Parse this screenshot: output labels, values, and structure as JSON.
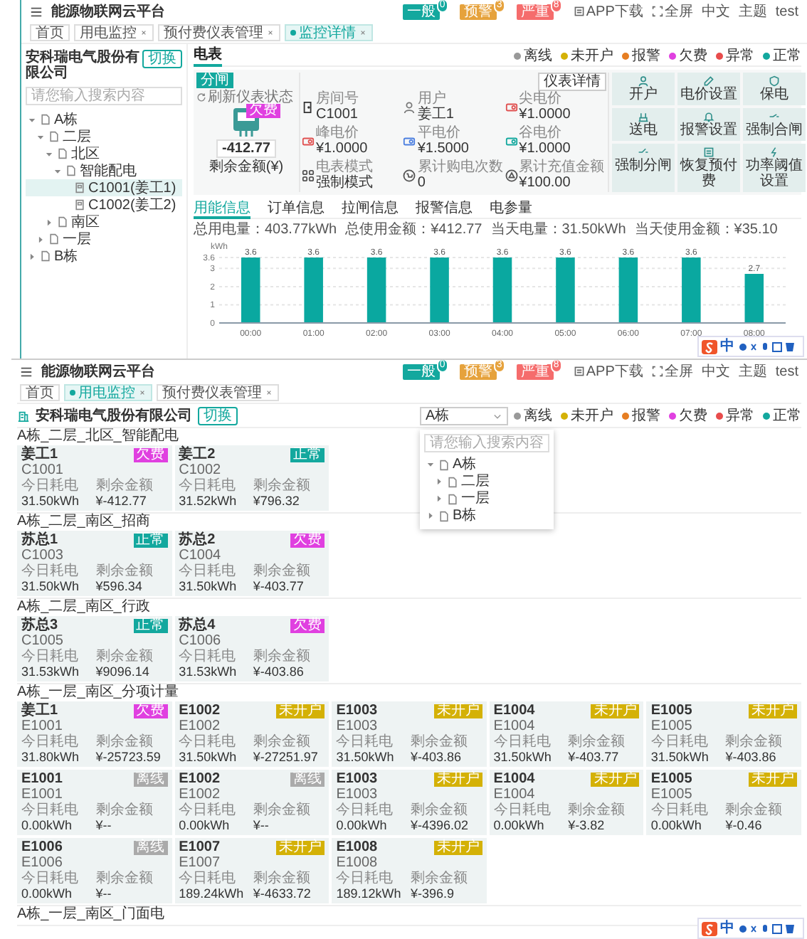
{
  "detail_screen": {
    "header": {
      "title": "能源物联网云平台",
      "alerts": [
        {
          "label": "一般",
          "count": "0",
          "color": "#13a89e"
        },
        {
          "label": "预警",
          "count": "3",
          "color": "#e6a23c"
        },
        {
          "label": "严重",
          "count": "8",
          "color": "#f56c6c"
        }
      ],
      "links": [
        {
          "kind": "app",
          "label": "APP下载"
        },
        {
          "kind": "fullscreen",
          "label": "全屏"
        },
        {
          "kind": "language",
          "label": "中文"
        },
        {
          "kind": "theme",
          "label": "主题"
        },
        {
          "kind": "user",
          "label": "test"
        }
      ]
    },
    "tabs": [
      {
        "label": "首页",
        "selected": false,
        "closable": false
      },
      {
        "label": "用电监控",
        "selected": false,
        "closable": true
      },
      {
        "label": "预付费仪表管理",
        "selected": false,
        "closable": true
      },
      {
        "label": "监控详情",
        "selected": true,
        "closable": true
      }
    ],
    "sidebar": {
      "company": "安科瑞电气股份有限公司",
      "switch_button": "切换",
      "placeholder": "请您输入搜索内容",
      "tree": [
        {
          "label": "A栋",
          "kind": "folder",
          "expanded": true,
          "selected": false,
          "children": [
            {
              "label": "二层",
              "kind": "folder",
              "expanded": true,
              "selected": false,
              "children": [
                {
                  "label": "北区",
                  "kind": "folder",
                  "expanded": true,
                  "selected": false,
                  "children": [
                    {
                      "label": "智能配电",
                      "kind": "folder",
                      "expanded": true,
                      "selected": false,
                      "children": [
                        {
                          "label": "C1001(姜工1)",
                          "kind": "meter",
                          "selected": true
                        },
                        {
                          "label": "C1002(姜工2)",
                          "kind": "meter",
                          "selected": false
                        }
                      ]
                    }
                  ]
                },
                {
                  "label": "南区",
                  "kind": "folder",
                  "expanded": false,
                  "selected": false
                }
              ]
            },
            {
              "label": "一层",
              "kind": "folder",
              "expanded": false,
              "selected": false
            }
          ]
        },
        {
          "label": "B栋",
          "kind": "folder",
          "expanded": false,
          "selected": false
        }
      ]
    },
    "main": {
      "tabs": [
        {
          "label": "电表",
          "selected": true
        }
      ],
      "legend": [
        {
          "label": "离线",
          "color": "#999999"
        },
        {
          "label": "未开户",
          "color": "#d4b106"
        },
        {
          "label": "报警",
          "color": "#e67e22"
        },
        {
          "label": "欠费",
          "color": "#e040e0"
        },
        {
          "label": "异常",
          "color": "#e84c4c"
        },
        {
          "label": "正常",
          "color": "#13a89e"
        }
      ],
      "meter": {
        "switch_state": "分闸",
        "refresh": "刷新仪表状态",
        "status": {
          "label": "欠费",
          "color": "#e040e0"
        },
        "balance": "-412.77",
        "balance_label": "剩余金额(¥)",
        "details_button": "仪表详情",
        "info": [
          {
            "kind": "room",
            "label": "房间号",
            "value": "C1001"
          },
          {
            "kind": "user",
            "label": "用户",
            "value": "姜工1"
          },
          {
            "kind": "tip_price",
            "label": "尖电价",
            "value": "¥1.0000"
          },
          {
            "kind": "peak_price",
            "label": "峰电价",
            "value": "¥1.0000"
          },
          {
            "kind": "flat_price",
            "label": "平电价",
            "value": "¥1.5000"
          },
          {
            "kind": "valley_price",
            "label": "谷电价",
            "value": "¥1.0000"
          },
          {
            "kind": "mode",
            "label": "电表模式",
            "value": "强制模式"
          },
          {
            "kind": "purchase_count",
            "label": "累计购电次数",
            "value": "0"
          },
          {
            "kind": "recharge_total",
            "label": "累计充值金额",
            "value": "¥100.00"
          }
        ],
        "actions": [
          {
            "kind": "open_account",
            "label": "开户"
          },
          {
            "kind": "price_setting",
            "label": "电价设置"
          },
          {
            "kind": "power_guarantee",
            "label": "保电"
          },
          {
            "kind": "power_on",
            "label": "送电"
          },
          {
            "kind": "alarm_setting",
            "label": "报警设置"
          },
          {
            "kind": "force_close",
            "label": "强制合闸"
          },
          {
            "kind": "force_open",
            "label": "强制分闸"
          },
          {
            "kind": "restore_prepaid",
            "label": "恢复预付费"
          },
          {
            "kind": "power_threshold",
            "label": "功率阈值设置"
          }
        ]
      },
      "sub_tabs": [
        {
          "label": "用能信息",
          "selected": true
        },
        {
          "label": "订单信息",
          "selected": false
        },
        {
          "label": "拉闸信息",
          "selected": false
        },
        {
          "label": "报警信息",
          "selected": false
        },
        {
          "label": "电参量",
          "selected": false
        }
      ],
      "stats": [
        "总用电量：403.77kWh",
        "总使用金额：¥412.77",
        "当天电量：31.50kWh",
        "当天使用金额：¥35.10"
      ],
      "chart_data": {
        "type": "bar",
        "ylabel": "kWh",
        "categories": [
          "00:00",
          "01:00",
          "02:00",
          "03:00",
          "04:00",
          "05:00",
          "06:00",
          "07:00",
          "08:00"
        ],
        "values": [
          3.6,
          3.6,
          3.6,
          3.6,
          3.6,
          3.6,
          3.6,
          3.6,
          2.7
        ],
        "ylim": [
          0,
          3.6
        ],
        "yticks": [
          0,
          1,
          2,
          3,
          3.6
        ],
        "grid": true,
        "data_labels": true
      }
    },
    "ime_toolbar": {
      "mode": "中"
    }
  },
  "overview_screen": {
    "header": {
      "title": "能源物联网云平台",
      "alerts": [
        {
          "label": "一般",
          "count": "0",
          "color": "#13a89e"
        },
        {
          "label": "预警",
          "count": "3",
          "color": "#e6a23c"
        },
        {
          "label": "严重",
          "count": "8",
          "color": "#f56c6c"
        }
      ],
      "links": [
        {
          "kind": "app",
          "label": "APP下载"
        },
        {
          "kind": "fullscreen",
          "label": "全屏"
        },
        {
          "kind": "language",
          "label": "中文"
        },
        {
          "kind": "theme",
          "label": "主题"
        },
        {
          "kind": "user",
          "label": "test"
        }
      ]
    },
    "tabs": [
      {
        "label": "首页",
        "selected": false,
        "closable": false
      },
      {
        "label": "用电监控",
        "selected": true,
        "closable": true
      },
      {
        "label": "预付费仪表管理",
        "selected": false,
        "closable": true
      }
    ],
    "company": "安科瑞电气股份有限公司",
    "switch_button": "切换",
    "select": {
      "value": "A栋"
    },
    "dropdown": {
      "placeholder": "请您输入搜索内容",
      "tree": [
        {
          "label": "A栋",
          "kind": "folder",
          "expanded": true,
          "selected": false,
          "children": [
            {
              "label": "二层",
              "kind": "folder",
              "expanded": false,
              "selected": false
            },
            {
              "label": "一层",
              "kind": "folder",
              "expanded": false,
              "selected": false
            }
          ]
        },
        {
          "label": "B栋",
          "kind": "folder",
          "expanded": false,
          "selected": false
        }
      ]
    },
    "legend": [
      {
        "label": "离线",
        "color": "#999999"
      },
      {
        "label": "未开户",
        "color": "#d4b106"
      },
      {
        "label": "报警",
        "color": "#e67e22"
      },
      {
        "label": "欠费",
        "color": "#e040e0"
      },
      {
        "label": "异常",
        "color": "#e84c4c"
      },
      {
        "label": "正常",
        "color": "#13a89e"
      }
    ],
    "groups": [
      {
        "title": "A栋_二层_北区_智能配电",
        "cards": [
          {
            "name": "姜工1",
            "code": "C1001",
            "status": "欠费",
            "color": "#e040e0",
            "usage_label": "今日耗电",
            "usage": "31.50kWh",
            "balance_label": "剩余金额",
            "balance": "¥-412.77"
          },
          {
            "name": "姜工2",
            "code": "C1002",
            "status": "正常",
            "color": "#13a89e",
            "usage_label": "今日耗电",
            "usage": "31.52kWh",
            "balance_label": "剩余金额",
            "balance": "¥796.32"
          }
        ]
      },
      {
        "title": "A栋_二层_南区_招商",
        "cards": [
          {
            "name": "苏总1",
            "code": "C1003",
            "status": "正常",
            "color": "#13a89e",
            "usage_label": "今日耗电",
            "usage": "31.50kWh",
            "balance_label": "剩余金额",
            "balance": "¥596.34"
          },
          {
            "name": "苏总2",
            "code": "C1004",
            "status": "欠费",
            "color": "#e040e0",
            "usage_label": "今日耗电",
            "usage": "31.50kWh",
            "balance_label": "剩余金额",
            "balance": "¥-403.77"
          }
        ]
      },
      {
        "title": "A栋_二层_南区_行政",
        "cards": [
          {
            "name": "苏总3",
            "code": "C1005",
            "status": "正常",
            "color": "#13a89e",
            "usage_label": "今日耗电",
            "usage": "31.53kWh",
            "balance_label": "剩余金额",
            "balance": "¥9096.14"
          },
          {
            "name": "苏总4",
            "code": "C1006",
            "status": "欠费",
            "color": "#e040e0",
            "usage_label": "今日耗电",
            "usage": "31.53kWh",
            "balance_label": "剩余金额",
            "balance": "¥-403.86"
          }
        ]
      },
      {
        "title": "A栋_一层_南区_分项计量",
        "cards": [
          {
            "name": "姜工1",
            "code": "E1001",
            "status": "欠费",
            "color": "#e040e0",
            "usage_label": "今日耗电",
            "usage": "31.80kWh",
            "balance_label": "剩余金额",
            "balance": "¥-25723.59"
          },
          {
            "name": "E1002",
            "code": "E1002",
            "status": "未开户",
            "color": "#d4b106",
            "usage_label": "今日耗电",
            "usage": "31.50kWh",
            "balance_label": "剩余金额",
            "balance": "¥-27251.97"
          },
          {
            "name": "E1003",
            "code": "E1003",
            "status": "未开户",
            "color": "#d4b106",
            "usage_label": "今日耗电",
            "usage": "31.50kWh",
            "balance_label": "剩余金额",
            "balance": "¥-403.86"
          },
          {
            "name": "E1004",
            "code": "E1004",
            "status": "未开户",
            "color": "#d4b106",
            "usage_label": "今日耗电",
            "usage": "31.50kWh",
            "balance_label": "剩余金额",
            "balance": "¥-403.77"
          },
          {
            "name": "E1005",
            "code": "E1005",
            "status": "未开户",
            "color": "#d4b106",
            "usage_label": "今日耗电",
            "usage": "31.50kWh",
            "balance_label": "剩余金额",
            "balance": "¥-403.86"
          },
          {
            "name": "E1001",
            "code": "E1001",
            "status": "离线",
            "color": "#aaaaaa",
            "usage_label": "今日耗电",
            "usage": "0.00kWh",
            "balance_label": "剩余金额",
            "balance": "¥--"
          },
          {
            "name": "E1002",
            "code": "E1002",
            "status": "离线",
            "color": "#aaaaaa",
            "usage_label": "今日耗电",
            "usage": "0.00kWh",
            "balance_label": "剩余金额",
            "balance": "¥--"
          },
          {
            "name": "E1003",
            "code": "E1003",
            "status": "未开户",
            "color": "#d4b106",
            "usage_label": "今日耗电",
            "usage": "0.00kWh",
            "balance_label": "剩余金额",
            "balance": "¥-4396.02"
          },
          {
            "name": "E1004",
            "code": "E1004",
            "status": "未开户",
            "color": "#d4b106",
            "usage_label": "今日耗电",
            "usage": "0.00kWh",
            "balance_label": "剩余金额",
            "balance": "¥-3.82"
          },
          {
            "name": "E1005",
            "code": "E1005",
            "status": "未开户",
            "color": "#d4b106",
            "usage_label": "今日耗电",
            "usage": "0.00kWh",
            "balance_label": "剩余金额",
            "balance": "¥-0.46"
          },
          {
            "name": "E1006",
            "code": "E1006",
            "status": "离线",
            "color": "#aaaaaa",
            "usage_label": "今日耗电",
            "usage": "0.00kWh",
            "balance_label": "剩余金额",
            "balance": "¥--"
          },
          {
            "name": "E1007",
            "code": "E1007",
            "status": "未开户",
            "color": "#d4b106",
            "usage_label": "今日耗电",
            "usage": "189.24kWh",
            "balance_label": "剩余金额",
            "balance": "¥-4633.72"
          },
          {
            "name": "E1008",
            "code": "E1008",
            "status": "未开户",
            "color": "#d4b106",
            "usage_label": "今日耗电",
            "usage": "189.12kWh",
            "balance_label": "剩余金额",
            "balance": "¥-396.9"
          }
        ]
      },
      {
        "title": "A栋_一层_南区_门面电"
      }
    ],
    "ime_toolbar": {
      "mode": "中"
    }
  }
}
